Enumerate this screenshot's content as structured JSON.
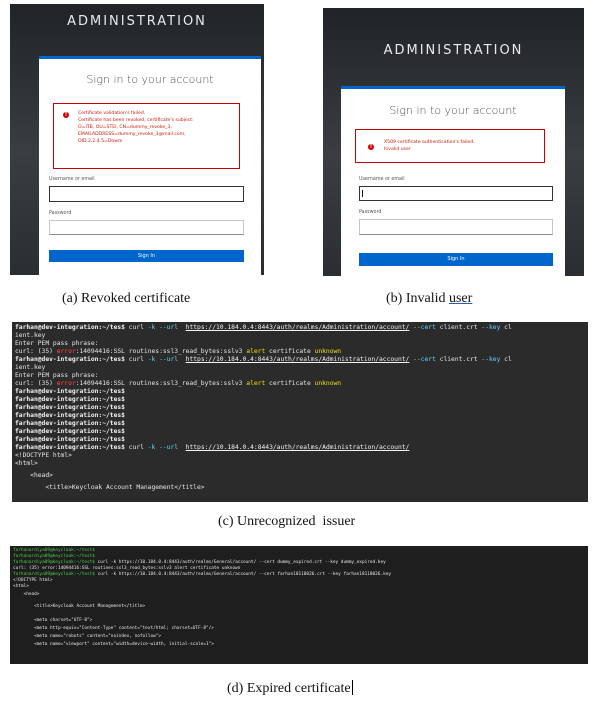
{
  "panel_a": {
    "admin_title": "ADMINISTRATION",
    "heading": "Sign in to your account",
    "alert_lines": [
      "Certificate validation's failed.",
      "Certificate has been revoked, certificate's subject:",
      "O=ITB, OU=STEI, CN=dummy_revoke_3,",
      "EMAILADDRESS=dummy_revoke_3@mail.com,",
      "OID.2.2.4.5=Dowm"
    ],
    "username_label": "Username or email",
    "password_label": "Password",
    "signin_label": "Sign In"
  },
  "panel_b": {
    "admin_title": "ADMINISTRATION",
    "heading": "Sign in to your account",
    "alert_lines": [
      "X509 certificate authentication's failed.",
      "Invalid user"
    ],
    "username_label": "Username or email",
    "password_label": "Password",
    "signin_label": "Sign In"
  },
  "captions": {
    "a": "(a) Revoked certificate",
    "b_prefix": "(b) Invalid ",
    "b_underlined": "user",
    "c": "(c) Unrecognized  issuer",
    "d": "(d) Expired certificate"
  },
  "terminal_c": {
    "prompt": "farhan@dev-integration:~/tes$",
    "curl": "curl",
    "opt_k": "-k",
    "opt_url": "--url",
    "url": "https://10.184.0.4:8443/auth/realms/Administration/account/",
    "opt_cert": "--cert",
    "cert_file": "client.crt",
    "opt_key": "--key",
    "key_tail": "cl",
    "wrap": "ient.key",
    "pem": "Enter PEM pass phrase:",
    "err_prefix": "curl: (35) ",
    "err_word": "error",
    "err_mid": ":14094416:SSL routines:ssl3_read_bytes:sslv3 ",
    "alert_word": "alert",
    "cert_word": " certificate ",
    "unknown_word": "unknown",
    "doctype": "<!DOCTYPE html>",
    "html_open": "<html>",
    "head_open": "    <head>",
    "title_line": "        <title>Keycloak Account Management</title>"
  },
  "terminal_d": {
    "prompt": "farhanardiya09@keycloak:~/test$",
    "cmd1": "curl -k https://10.184.0.4:8443/auth/realms/General/account/ --cert dummy_expired.crt --key dummy_expired.key",
    "err": "curl: (35) error:14094416:SSL routines:ssl3_read_bytes:sslv3 alert certificate unknown",
    "cmd2": "curl -k https://10.184.0.4:8443/auth/realms/General/account/ --cert farhan18118026.crt --key farhan18118026.key",
    "doctype": "<!DOCTYPE html>",
    "html_open": "<html>",
    "head_open": "    <head>",
    "title_line": "        <title>Keycloak Account Management</title>",
    "meta1": "        <meta charset=\"UTF-8\">",
    "meta2": "        <meta http-equiv=\"Content-Type\" content=\"text/html; charset=UTF-8\"/>",
    "meta3": "        <meta name=\"robots\" content=\"noindex, nofollow\">",
    "meta4": "        <meta name=\"viewport\" content=\"width=device-width, initial-scale=1\">"
  }
}
